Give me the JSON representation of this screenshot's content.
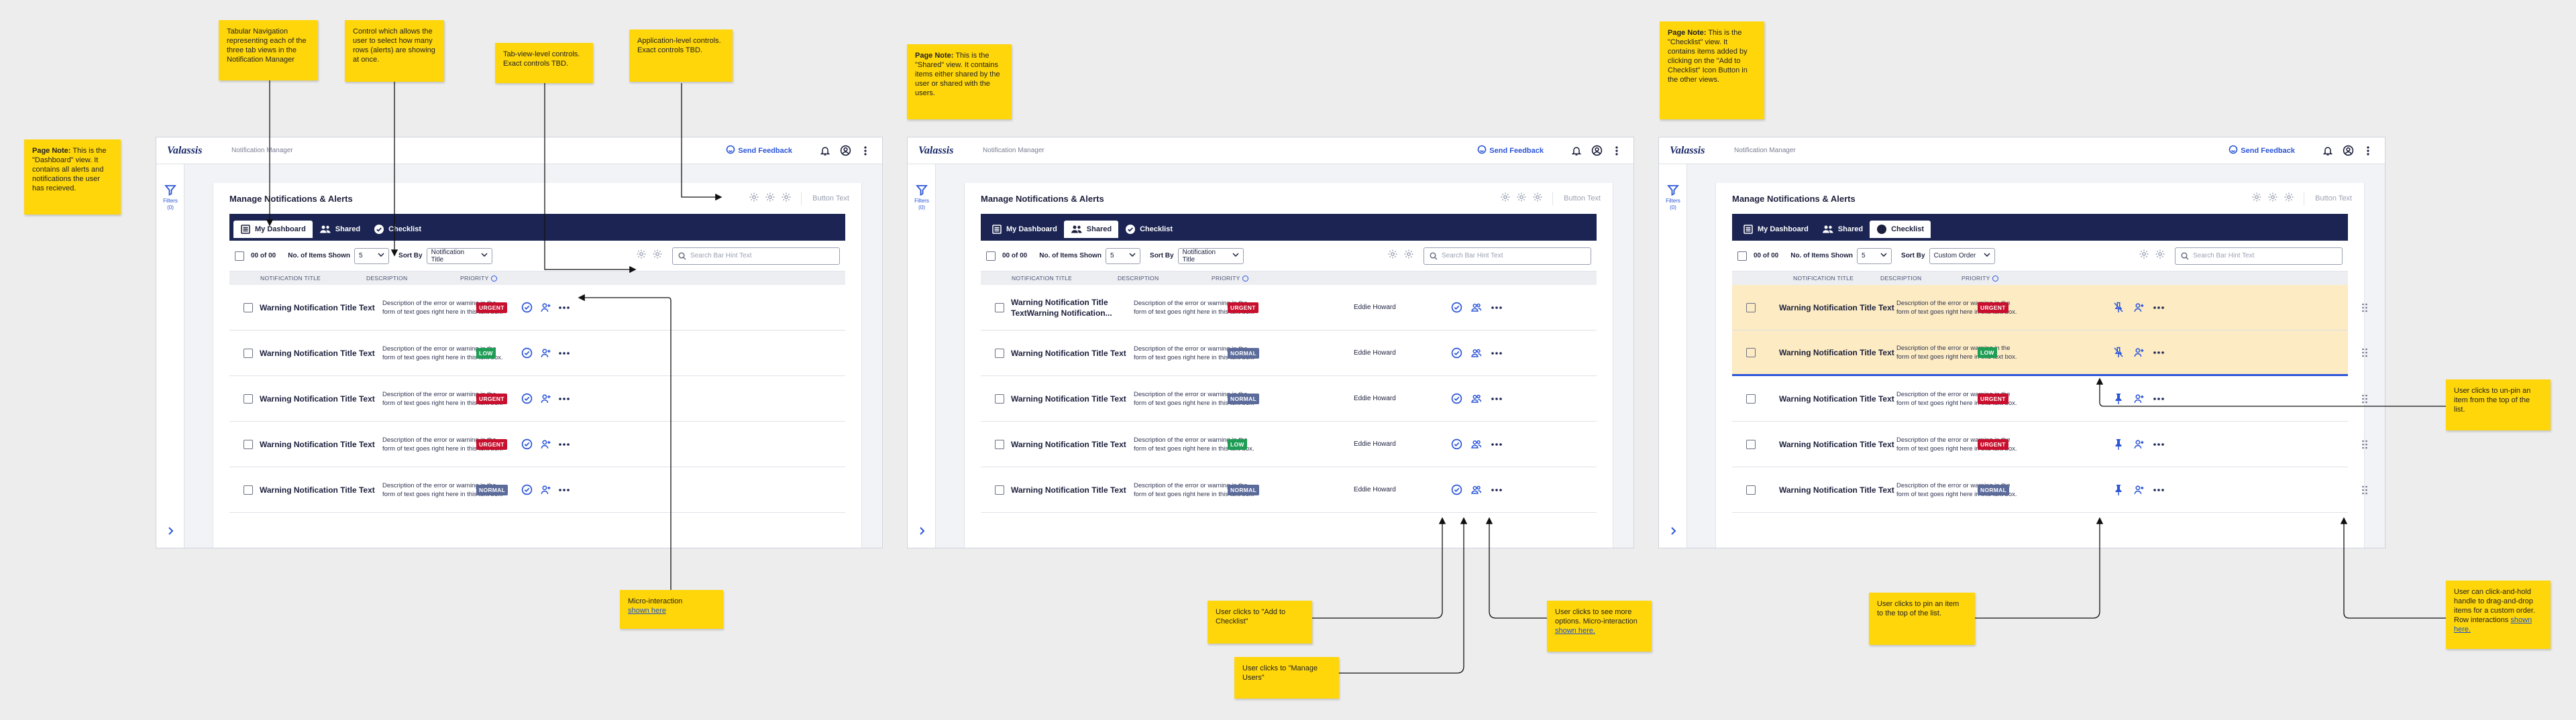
{
  "app": {
    "logo": "Valassis",
    "name": "Notification Manager",
    "feedback": "Send Feedback",
    "filters_label": "Filters",
    "filters_count": "(0)",
    "page_title": "Manage Notifications & Alerts",
    "button_text": "Button Text"
  },
  "tabs": [
    "My Dashboard",
    "Shared",
    "Checklist"
  ],
  "controls": {
    "count": "00 of 00",
    "items_label": "No. of Items Shown",
    "items_value": "5",
    "sort_label": "Sort By",
    "search_placeholder": "Search Bar Hint Text"
  },
  "columns": {
    "title": "NOTIFICATION TITLE",
    "description": "DESCRIPTION",
    "priority": "PRIORITY"
  },
  "colors": {
    "urgent": "#c8102e",
    "low": "#1f9d55",
    "normal": "#5b6b9a",
    "navy": "#1b2452",
    "accent": "#2b55d9",
    "note": "#ffd60a",
    "pinned": "#fcebc3"
  },
  "views": [
    {
      "sort_value": "Notification Title",
      "rows": [
        {
          "title": "Warning Notification Title Text",
          "desc1": "Description of the error or warning in the",
          "desc2": "form of text goes right here in this text box.",
          "priority": "URGENT"
        },
        {
          "title": "Warning Notification Title Text",
          "desc1": "Description of the error or warning in the",
          "desc2": "form of text goes right here in this text box.",
          "priority": "LOW"
        },
        {
          "title": "Warning Notification Title Text",
          "desc1": "Description of the error or warning in the",
          "desc2": "form of text goes right here in this text box.",
          "priority": "URGENT"
        },
        {
          "title": "Warning Notification Title Text",
          "desc1": "Description of the error or warning in the",
          "desc2": "form of text goes right here in this text box.",
          "priority": "URGENT"
        },
        {
          "title": "Warning Notification Title Text",
          "desc1": "Description of the error or warning in the",
          "desc2": "form of text goes right here in this text box.",
          "priority": "NORMAL"
        }
      ]
    },
    {
      "sort_value": "Notification Title",
      "rows": [
        {
          "title": "Warning Notification Title",
          "title2": "TextWarning Notification...",
          "desc1": "Description of the error or warning in the",
          "desc2": "form of text goes right here in this text box.",
          "priority": "URGENT",
          "user": "Eddie Howard"
        },
        {
          "title": "Warning Notification Title Text",
          "desc1": "Description of the error or warning in the",
          "desc2": "form of text goes right here in this text box.",
          "priority": "NORMAL",
          "user": "Eddie Howard"
        },
        {
          "title": "Warning Notification Title Text",
          "desc1": "Description of the error or warning in the",
          "desc2": "form of text goes right here in this text box.",
          "priority": "NORMAL",
          "user": "Eddie Howard"
        },
        {
          "title": "Warning Notification Title Text",
          "desc1": "Description of the error or warning in the",
          "desc2": "form of text goes right here in this text box.",
          "priority": "LOW",
          "user": "Eddie Howard"
        },
        {
          "title": "Warning Notification Title Text",
          "desc1": "Description of the error or warning in the",
          "desc2": "form of text goes right here in this text box.",
          "priority": "NORMAL",
          "user": "Eddie Howard"
        }
      ]
    },
    {
      "sort_value": "Custom Order",
      "rows": [
        {
          "title": "Warning Notification Title Text",
          "desc1": "Description of the error or warning in the",
          "desc2": "form of text goes right here in this text box.",
          "priority": "URGENT",
          "pinned": true
        },
        {
          "title": "Warning Notification Title Text",
          "desc1": "Description of the error or warning in the",
          "desc2": "form of text goes right here in this text box.",
          "priority": "LOW",
          "pinned": true
        },
        {
          "title": "Warning Notification Title Text",
          "desc1": "Description of the error or warning in the",
          "desc2": "form of text goes right here in this text box.",
          "priority": "URGENT",
          "pinned": false
        },
        {
          "title": "Warning Notification Title Text",
          "desc1": "Description of the error or warning in the",
          "desc2": "form of text goes right here in this text box.",
          "priority": "URGENT",
          "pinned": false
        },
        {
          "title": "Warning Notification Title Text",
          "desc1": "Description of the error or warning in the",
          "desc2": "form of text goes right here in this text box.",
          "priority": "NORMAL",
          "pinned": false
        }
      ]
    }
  ],
  "notes": {
    "dash_page_bold": "Page Note:",
    "dash_page": " This is the \"Dashboard\" view. It contains all alerts and notifications the user has recieved.",
    "tabnav": "Tabular Navigation representing each of the three tab views in the Notification Manager",
    "rows_control": "Control which allows the user to select how many rows (alerts) are showing at once.",
    "tabview_controls": "Tab-view-level controls. Exact controls TBD.",
    "app_controls": "Application-level controls. Exact controls TBD.",
    "micro": "Micro-interaction",
    "micro_link": "shown here",
    "shared_page_bold": "Page Note:",
    "shared_page": " This is the \"Shared\" view. It contains items either shared by the user or shared with the users.",
    "add_checklist": "User clicks to \"Add to Checklist\"",
    "manage_users": "User clicks to \"Manage Users\"",
    "more_options": "User clicks to see more options. Micro-interaction",
    "more_link": "shown here.",
    "checklist_page_bold": "Page Note:",
    "checklist_page": " This is the \"Checklist\" view. It contains items added by clicking on the \"Add to Checklist\" Icon Button in the other views.",
    "unpin": "User clicks to un-pin an item from the top of the list.",
    "pin": "User clicks to pin an item to the top of the list.",
    "drag": "User can click-and-hold handle to drag-and-drop items for a custom order. Row interactions",
    "drag_link": "shown here."
  }
}
